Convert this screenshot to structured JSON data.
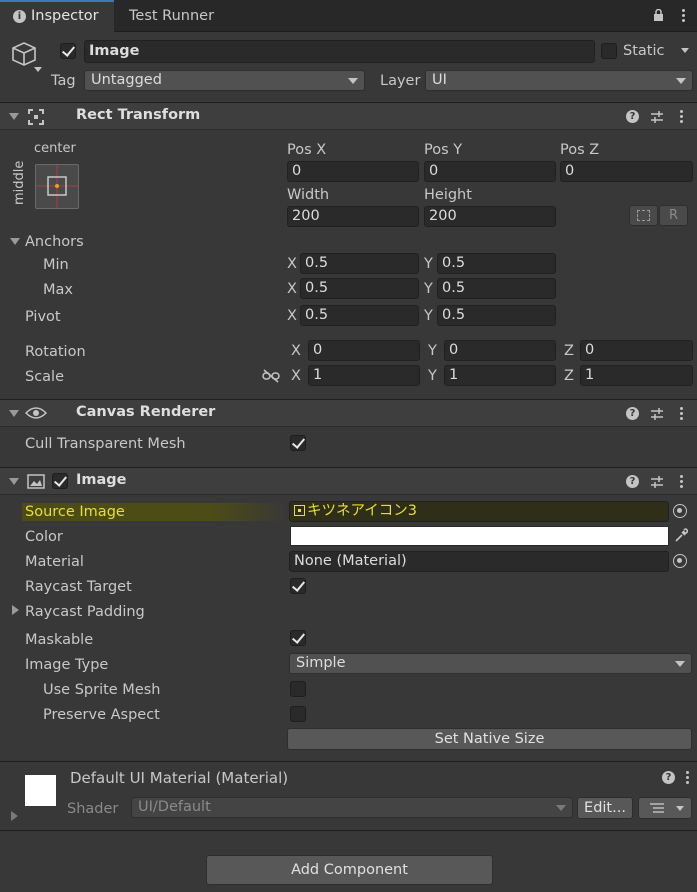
{
  "tabs": [
    {
      "label": "Inspector",
      "icon": "info-icon",
      "active": true
    },
    {
      "label": "Test Runner",
      "active": false
    }
  ],
  "object": {
    "name": "Image",
    "active": true,
    "static_label": "Static",
    "static": false,
    "tag_label": "Tag",
    "tag_value": "Untagged",
    "layer_label": "Layer",
    "layer_value": "UI"
  },
  "rect_transform": {
    "title": "Rect Transform",
    "anchor_preset_h": "center",
    "anchor_preset_v": "middle",
    "pos_x_label": "Pos X",
    "pos_x": "0",
    "pos_y_label": "Pos Y",
    "pos_y": "0",
    "pos_z_label": "Pos Z",
    "pos_z": "0",
    "width_label": "Width",
    "width": "200",
    "height_label": "Height",
    "height": "200",
    "raw_button": "R",
    "anchors_label": "Anchors",
    "min_label": "Min",
    "min_x": "0.5",
    "min_y": "0.5",
    "max_label": "Max",
    "max_x": "0.5",
    "max_y": "0.5",
    "pivot_label": "Pivot",
    "pivot_x": "0.5",
    "pivot_y": "0.5",
    "rotation_label": "Rotation",
    "rot_x": "0",
    "rot_y": "0",
    "rot_z": "0",
    "scale_label": "Scale",
    "scale_x": "1",
    "scale_y": "1",
    "scale_z": "1",
    "x": "X",
    "y": "Y",
    "z": "Z"
  },
  "canvas_renderer": {
    "title": "Canvas Renderer",
    "cull_label": "Cull Transparent Mesh",
    "cull": true
  },
  "image": {
    "title": "Image",
    "enabled": true,
    "source_image_label": "Source Image",
    "source_image_value": "キツネアイコン3",
    "color_label": "Color",
    "color_value": "#ffffff",
    "material_label": "Material",
    "material_value": "None (Material)",
    "raycast_target_label": "Raycast Target",
    "raycast_target": true,
    "raycast_padding_label": "Raycast Padding",
    "maskable_label": "Maskable",
    "maskable": true,
    "image_type_label": "Image Type",
    "image_type_value": "Simple",
    "use_sprite_mesh_label": "Use Sprite Mesh",
    "use_sprite_mesh": false,
    "preserve_aspect_label": "Preserve Aspect",
    "preserve_aspect": false,
    "set_native_size": "Set Native Size"
  },
  "material_preview": {
    "title": "Default UI Material (Material)",
    "shader_label": "Shader",
    "shader_value": "UI/Default",
    "edit_button": "Edit..."
  },
  "add_component": "Add Component",
  "colors": {
    "bg": "#383838",
    "header": "#3e3e3e",
    "field": "#2a2a2a",
    "highlight": "#4d4c16",
    "highlight_text": "#e8de3a"
  }
}
